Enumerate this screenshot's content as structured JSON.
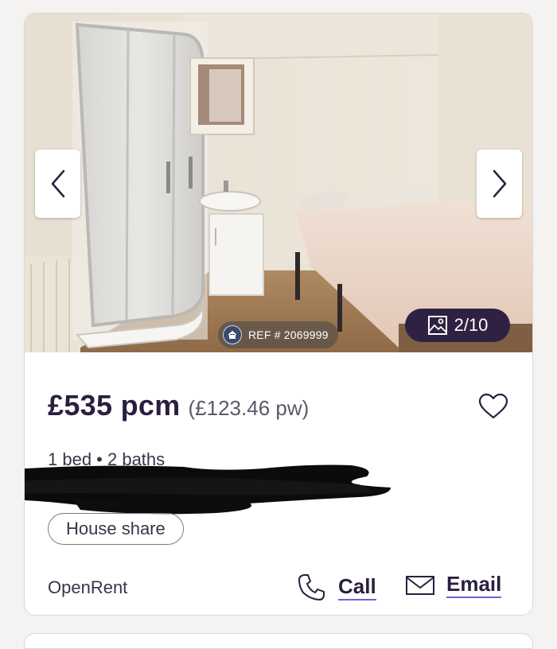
{
  "listing": {
    "image_counter": "2/10",
    "reference": "REF # 2069999",
    "price": "£535 pcm",
    "price_weekly": "(£123.46 pw)",
    "beds_baths": "1 bed • 2 baths",
    "tag": "House share",
    "agent": "OpenRent",
    "call_label": "Call",
    "email_label": "Email"
  },
  "icons": {
    "prev": "chevron-left-icon",
    "next": "chevron-right-icon",
    "reference": "house-icon",
    "gallery": "image-icon",
    "favourite": "heart-icon",
    "call": "phone-icon",
    "email": "envelope-icon"
  },
  "colors": {
    "brand_dark": "#2a1f3d",
    "link_underline": "#7b5cd6",
    "counter_bg": "#2f2142"
  }
}
